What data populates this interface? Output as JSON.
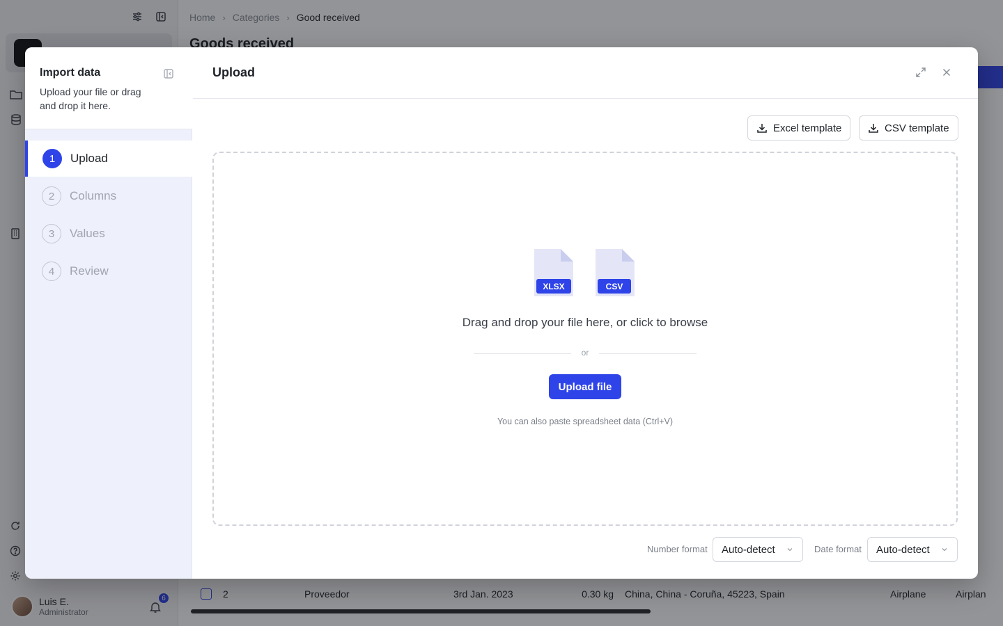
{
  "background": {
    "breadcrumb": [
      "Home",
      "Categories",
      "Good received"
    ],
    "page_title": "Goods received",
    "row": {
      "num": "2",
      "supplier": "Proveedor",
      "date": "3rd Jan. 2023",
      "weight": "0.30 kg",
      "address": "China, China - Coruña, 45223, Spain",
      "transport1": "Airplane",
      "transport2": "Airplan"
    },
    "user": {
      "name": "Luis E.",
      "role": "Administrator"
    },
    "notifications": "6"
  },
  "modal": {
    "sidebar": {
      "title": "Import data",
      "description": "Upload your file or drag and drop it here.",
      "steps": [
        {
          "num": "1",
          "label": "Upload"
        },
        {
          "num": "2",
          "label": "Columns"
        },
        {
          "num": "3",
          "label": "Values"
        },
        {
          "num": "4",
          "label": "Review"
        }
      ]
    },
    "title": "Upload",
    "excel_template": "Excel template",
    "csv_template": "CSV template",
    "dropzone": {
      "file_types": [
        "XLSX",
        "CSV"
      ],
      "title": "Drag and drop your file here, or click to browse",
      "or": "or",
      "upload_button": "Upload file",
      "hint": "You can also paste spreadsheet data (Ctrl+V)"
    },
    "number_format": {
      "label": "Number format",
      "value": "Auto-detect"
    },
    "date_format": {
      "label": "Date format",
      "value": "Auto-detect"
    }
  },
  "colors": {
    "accent": "#2f44e8",
    "overlay": "rgba(20,22,28,0.46)"
  }
}
